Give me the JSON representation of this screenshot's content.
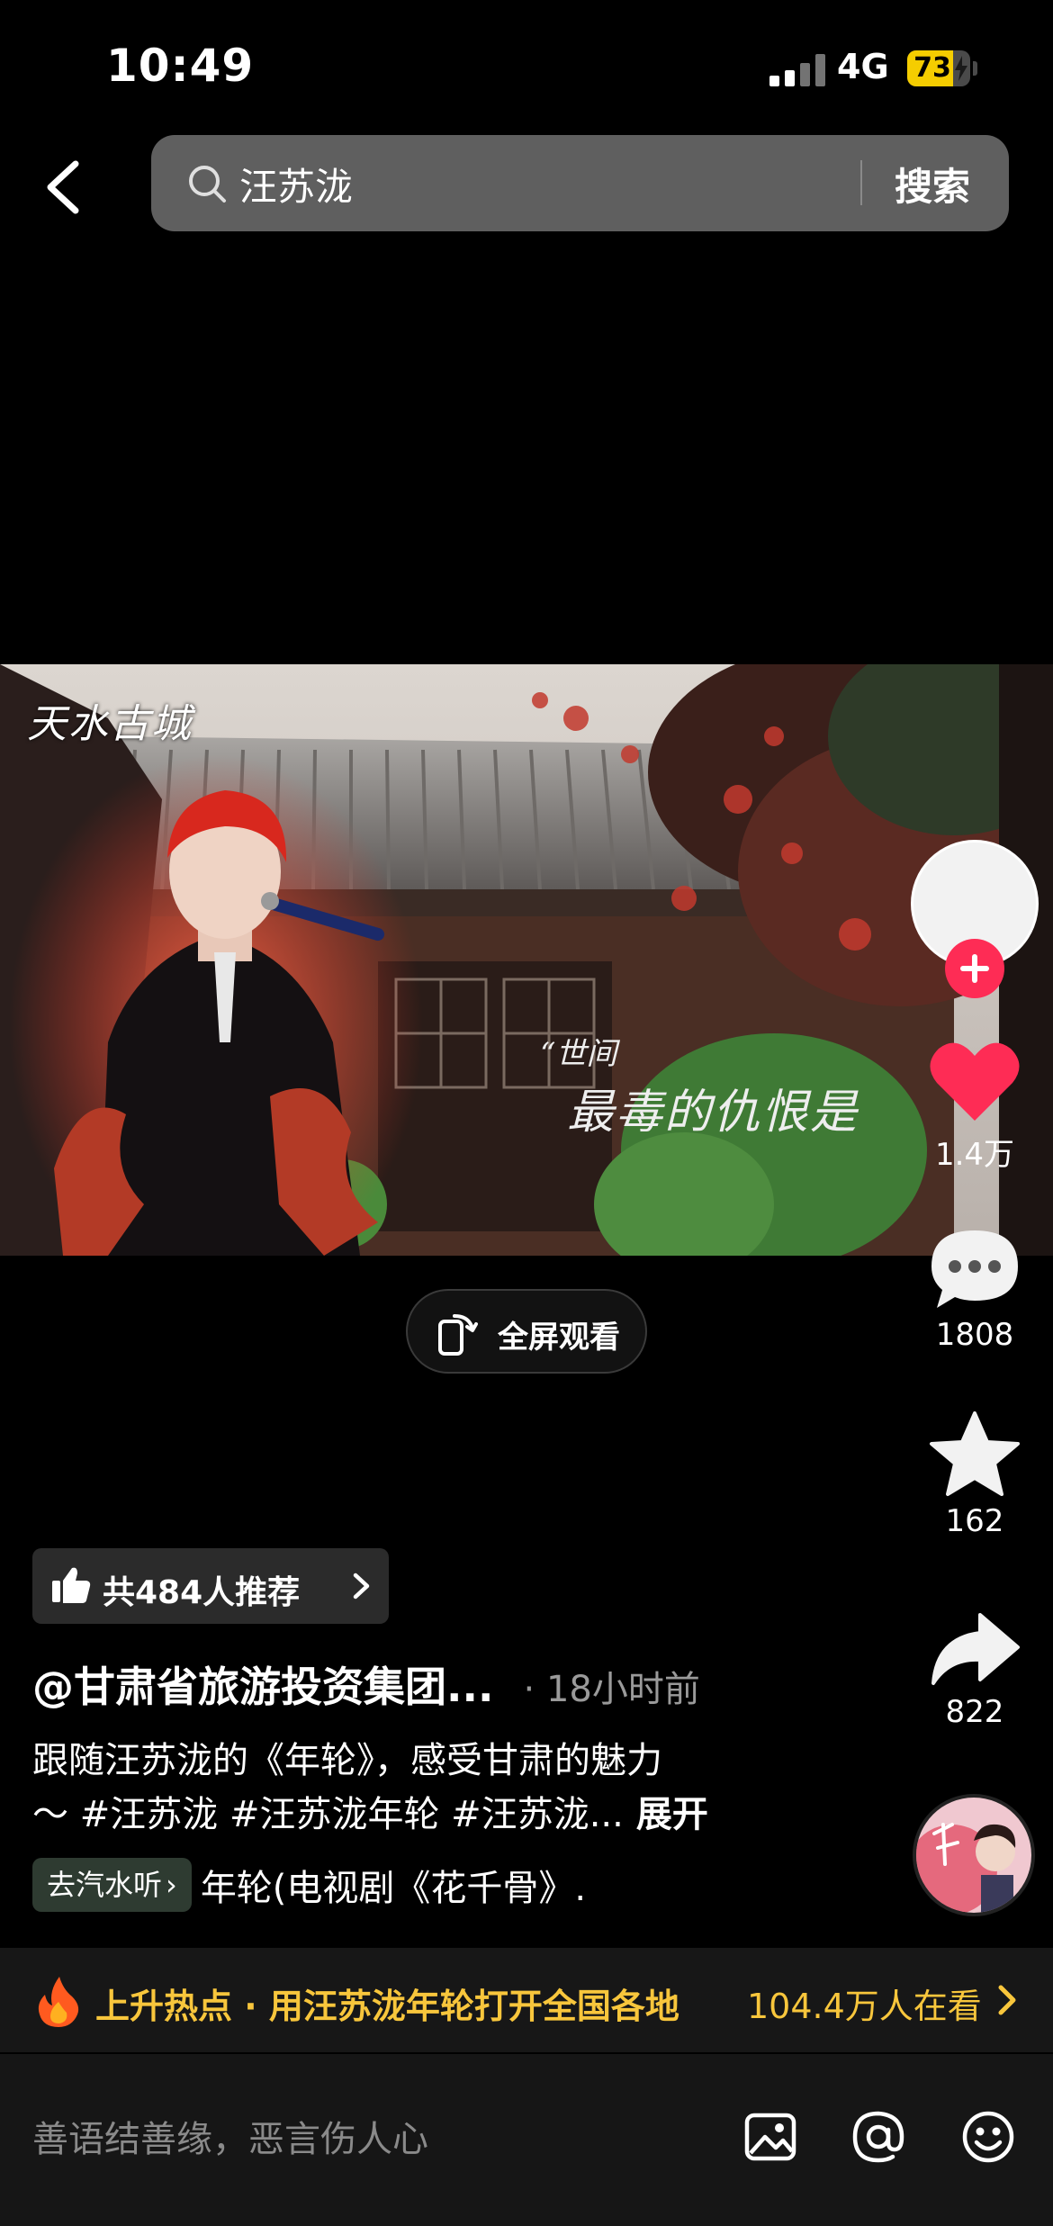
{
  "status_bar": {
    "time": "10:49",
    "network": "4G",
    "battery": "73",
    "battery_level": 0.73
  },
  "search": {
    "query": "汪苏泷",
    "button_label": "搜索"
  },
  "video": {
    "watermark_text": "天水古城",
    "caption_line1": "“世间",
    "caption_line2": "最毒的仇恨是"
  },
  "fullscreen": {
    "label": "全屏观看"
  },
  "actions": {
    "likes": "1.4万",
    "comments": "1808",
    "favorites": "162",
    "shares": "822"
  },
  "recommend": {
    "label": "共484人推荐"
  },
  "post": {
    "author": "@甘肃省旅游投资集团...",
    "time": "· 18小时前",
    "description_line1": "跟随汪苏泷的《年轮》，感受甘肃的魅力",
    "description_line2": "～ #汪苏泷 #汪苏泷年轮 #汪苏泷...",
    "expand": "展开"
  },
  "music": {
    "qishui_label": "去汽水听",
    "title": "年轮(电视剧《花千骨》."
  },
  "hot": {
    "text": "上升热点 · 用汪苏泷年轮打开全国各地",
    "viewers": "104.4万人在看"
  },
  "comment": {
    "placeholder": "善语结善缘，恶言伤人心"
  },
  "colors": {
    "like_red": "#fe2c55",
    "hot_yellow": "#f8c63c",
    "battery_yellow": "#f5cd00"
  },
  "icons": [
    "back-chevron-icon",
    "search-icon",
    "fullscreen-icon",
    "plus-icon",
    "heart-icon",
    "comment-bubble-icon",
    "star-icon",
    "share-arrow-icon",
    "thumbs-up-icon",
    "fire-icon",
    "image-icon",
    "at-icon",
    "emoji-icon"
  ]
}
